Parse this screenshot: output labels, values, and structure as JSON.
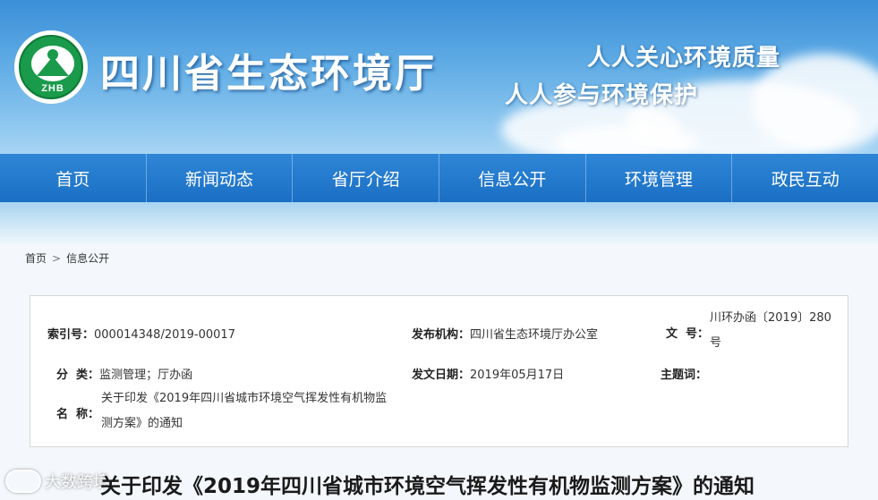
{
  "header": {
    "logo_text": "ZHB",
    "site_title": "四川省生态环境厅",
    "slogan_1": "人人关心环境质量",
    "slogan_2": "人人参与环境保护"
  },
  "nav": {
    "items": [
      "首页",
      "新闻动态",
      "省厅介绍",
      "信息公开",
      "环境管理",
      "政民互动"
    ]
  },
  "breadcrumb": {
    "home": "首页",
    "separator": ">",
    "current": "信息公开"
  },
  "meta": {
    "index_label": "索引号：",
    "index_value": "000014348/2019-00017",
    "publisher_label": "发布机构：",
    "publisher_value": "四川省生态环境厅办公室",
    "docno_label": "文  号：",
    "docno_value": "川环办函〔2019〕280号",
    "category_label": "分  类：",
    "category_value": "监测管理；厅办函",
    "date_label": "发文日期：",
    "date_value": "2019年05月17日",
    "topic_label": "主题词：",
    "topic_value": "",
    "name_label": "名  称：",
    "name_value": "关于印发《2019年四川省城市环境空气挥发性有机物监测方案》的通知"
  },
  "article": {
    "title": "关于印发《2019年四川省城市环境空气挥发性有机物监测方案》的通知"
  },
  "watermark": {
    "text": "大数跨境"
  }
}
